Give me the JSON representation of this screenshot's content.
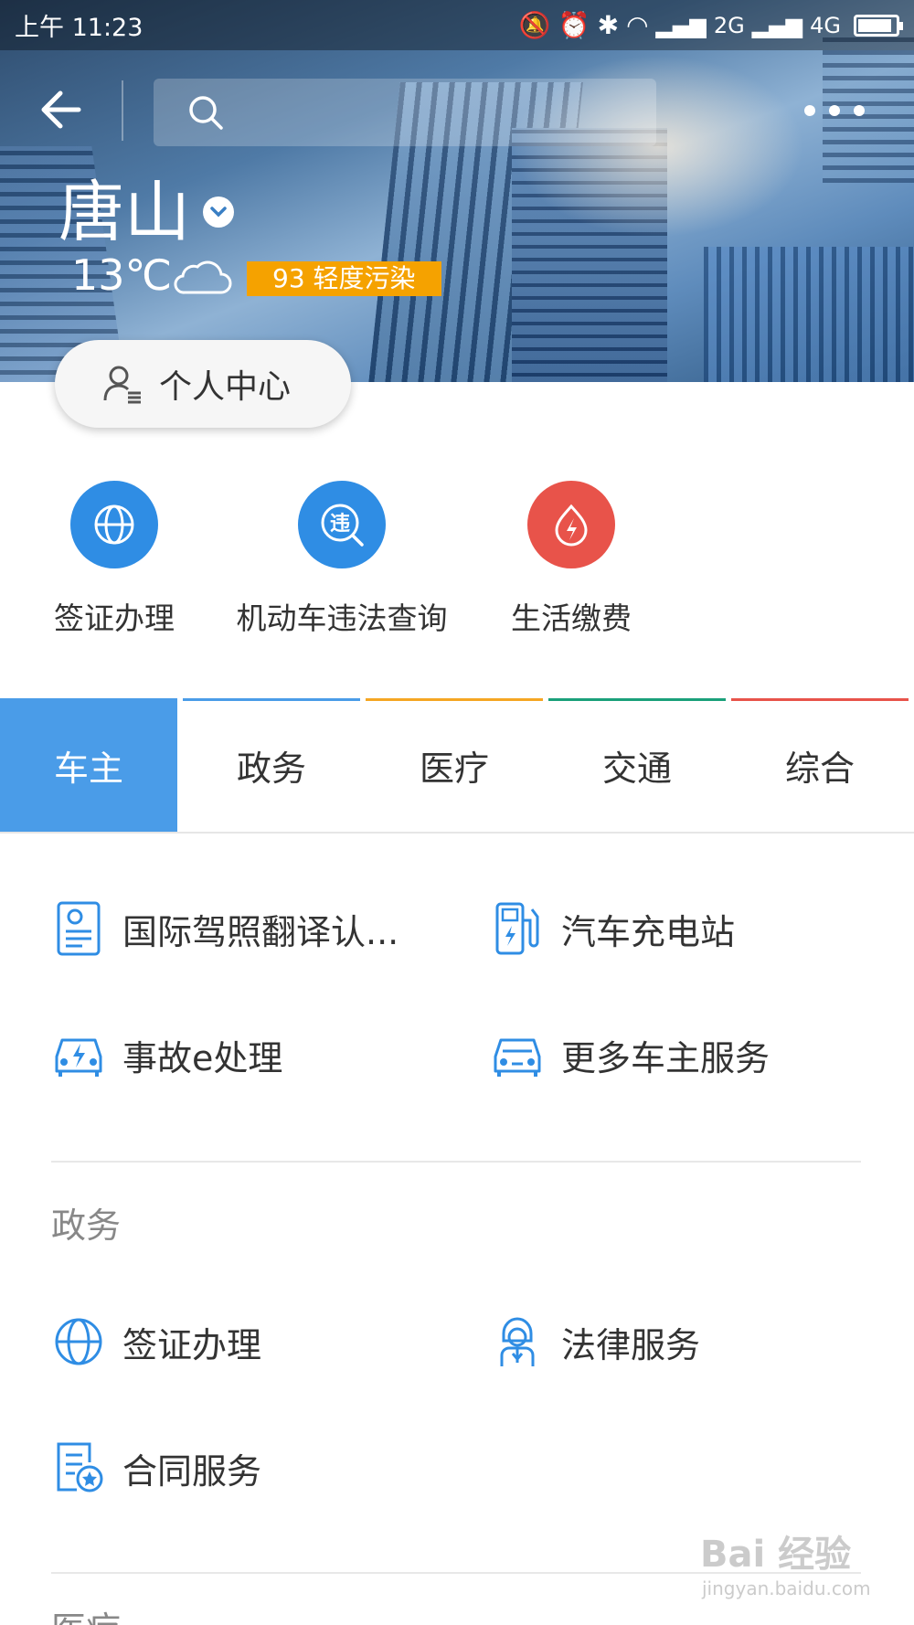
{
  "status_bar": {
    "time": "上午 11:23",
    "net1": "2G",
    "net2": "4G",
    "battery_level": 0.9
  },
  "header": {
    "search_placeholder": "",
    "city": "唐山",
    "temperature": "13℃",
    "aqi_label": "93 轻度污染",
    "profile_label": "个人中心"
  },
  "quick_services": [
    {
      "label": "签证办理",
      "icon": "globe-icon",
      "color": "#2f8de4"
    },
    {
      "label": "机动车违法查询",
      "icon": "violation-icon",
      "color": "#2f8de4"
    },
    {
      "label": "生活缴费",
      "icon": "lightning-icon",
      "color": "#e8534a"
    }
  ],
  "tabs": [
    {
      "label": "车主",
      "bar_color": "#4a9ce8",
      "active": true
    },
    {
      "label": "政务",
      "bar_color": "#4a9ce8",
      "active": false
    },
    {
      "label": "医疗",
      "bar_color": "#f5a623",
      "active": false
    },
    {
      "label": "交通",
      "bar_color": "#1aa07a",
      "active": false
    },
    {
      "label": "综合",
      "bar_color": "#e8534a",
      "active": false
    }
  ],
  "sections": {
    "car_owner": [
      {
        "label": "国际驾照翻译认...",
        "icon": "license-icon"
      },
      {
        "label": "汽车充电站",
        "icon": "charging-station-icon"
      },
      {
        "label": "事故e处理",
        "icon": "car-accident-icon"
      },
      {
        "label": "更多车主服务",
        "icon": "car-icon"
      }
    ],
    "government_title": "政务",
    "government": [
      {
        "label": "签证办理",
        "icon": "globe-icon"
      },
      {
        "label": "法律服务",
        "icon": "lawyer-icon"
      },
      {
        "label": "合同服务",
        "icon": "contract-icon"
      }
    ],
    "medical_title": "医疗"
  },
  "watermark": {
    "text": "Bai 经验",
    "sub": "jingyan.baidu.com"
  },
  "colors": {
    "accent_blue": "#4a9ce8",
    "icon_blue": "#2f8de4",
    "aqi_orange": "#f5a200"
  }
}
